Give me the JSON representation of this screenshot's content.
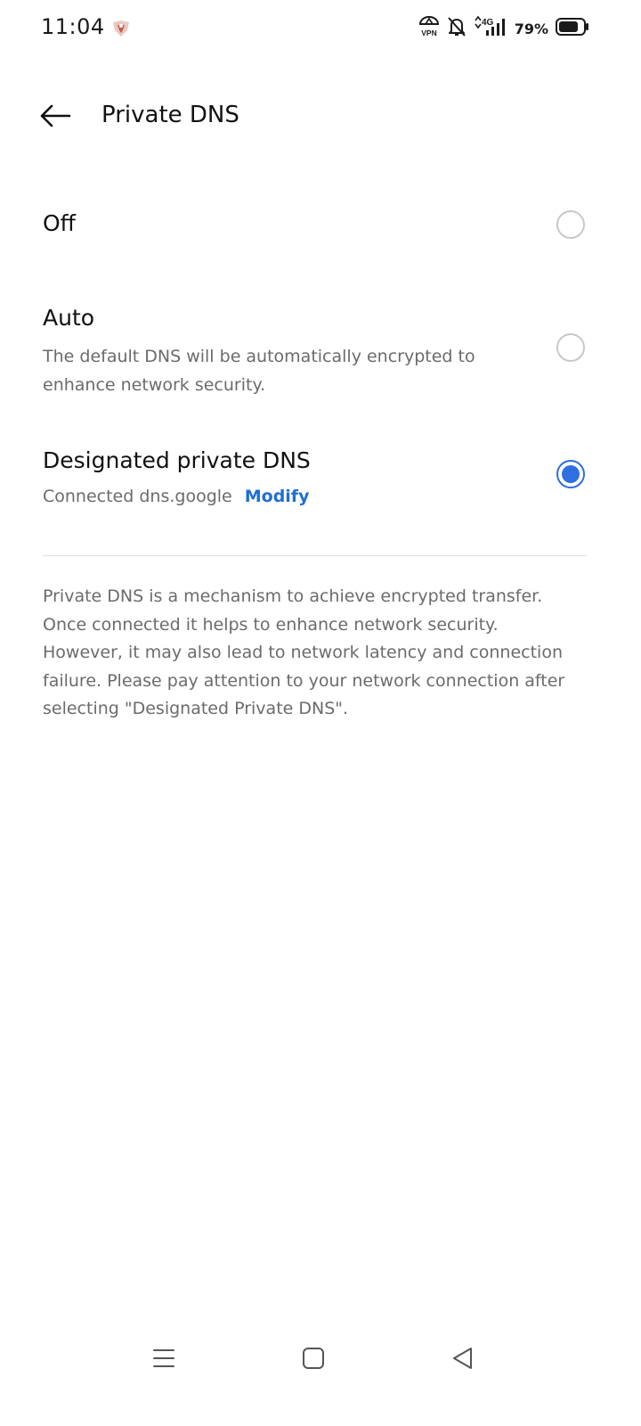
{
  "status_bar": {
    "time": "11:04",
    "battery_percent": "79%",
    "network": "4G",
    "vpn_label": "VPN",
    "icons": [
      "app-notification-icon",
      "vpn-icon",
      "bell-off-icon",
      "signal-icon",
      "battery-icon"
    ]
  },
  "app_bar": {
    "title": "Private DNS",
    "back_icon": "back-arrow-icon"
  },
  "options": {
    "off": {
      "label": "Off",
      "selected": false
    },
    "auto": {
      "label": "Auto",
      "description": "The default DNS will be automatically encrypted to enhance network security.",
      "selected": false
    },
    "designated": {
      "label": "Designated private DNS",
      "status": "Connected dns.google",
      "action_label": "Modify",
      "selected": true
    }
  },
  "info": {
    "text": "Private DNS is a mechanism to achieve encrypted transfer. Once connected it helps to enhance network security. However, it may also lead to network latency and connection failure. Please pay attention to your network connection after selecting \"Designated Private DNS\"."
  },
  "nav_bar": {
    "icons": [
      "menu-icon",
      "home-icon",
      "back-triangle-icon"
    ]
  },
  "colors": {
    "accent": "#2f6fe0",
    "link": "#1f6fd1",
    "secondary_text": "#6b6b6b",
    "divider": "#dedede"
  }
}
